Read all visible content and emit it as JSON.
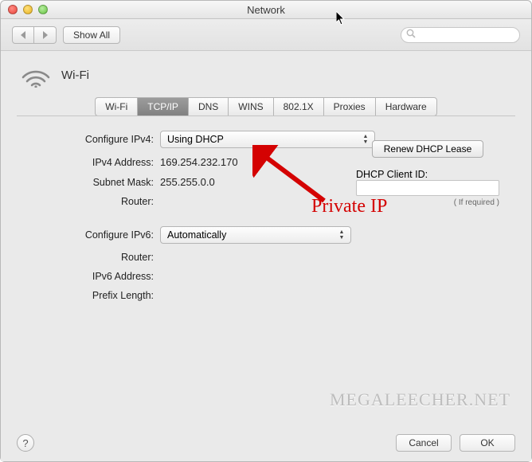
{
  "window": {
    "title": "Network"
  },
  "toolbar": {
    "show_all": "Show All"
  },
  "header": {
    "interface": "Wi-Fi"
  },
  "tabs": [
    "Wi-Fi",
    "TCP/IP",
    "DNS",
    "WINS",
    "802.1X",
    "Proxies",
    "Hardware"
  ],
  "active_tab": "TCP/IP",
  "labels": {
    "configure_ipv4": "Configure IPv4:",
    "ipv4_address": "IPv4 Address:",
    "subnet_mask": "Subnet Mask:",
    "router4": "Router:",
    "configure_ipv6": "Configure IPv6:",
    "router6": "Router:",
    "ipv6_address": "IPv6 Address:",
    "prefix_length": "Prefix Length:",
    "dhcp_client_id": "DHCP Client ID:",
    "if_required": "( If required )"
  },
  "values": {
    "configure_ipv4": "Using DHCP",
    "ipv4_address": "169.254.232.170",
    "subnet_mask": "255.255.0.0",
    "router4": "",
    "configure_ipv6": "Automatically",
    "router6": "",
    "ipv6_address": "",
    "prefix_length": "",
    "dhcp_client_id": ""
  },
  "buttons": {
    "renew_dhcp": "Renew DHCP Lease",
    "cancel": "Cancel",
    "ok": "OK"
  },
  "annotation": {
    "private_ip": "Private IP"
  },
  "watermark": "MEGALEECHER.NET"
}
